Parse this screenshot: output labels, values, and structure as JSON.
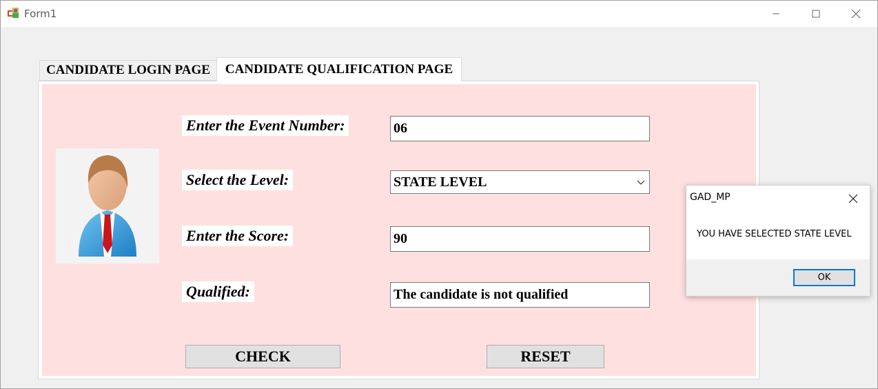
{
  "window": {
    "title": "Form1",
    "icon": "winforms-app-icon"
  },
  "tabs": [
    {
      "label": "CANDIDATE LOGIN PAGE",
      "selected": false
    },
    {
      "label": "CANDIDATE QUALIFICATION PAGE",
      "selected": true
    }
  ],
  "form": {
    "event_label": "Enter the Event Number:",
    "event_value": "06",
    "level_label": "Select the Level:",
    "level_value": "STATE LEVEL",
    "score_label": "Enter the Score:",
    "score_value": "90",
    "qualified_label": "Qualified:",
    "qualified_value": "The candidate is not qualified",
    "check_label": "CHECK",
    "reset_label": "RESET"
  },
  "message_box": {
    "title": "GAD_MP",
    "text": "YOU HAVE SELECTED STATE LEVEL",
    "ok_label": "OK"
  },
  "colors": {
    "panel_background": "#ffe0e0",
    "accent": "#0078d7"
  }
}
